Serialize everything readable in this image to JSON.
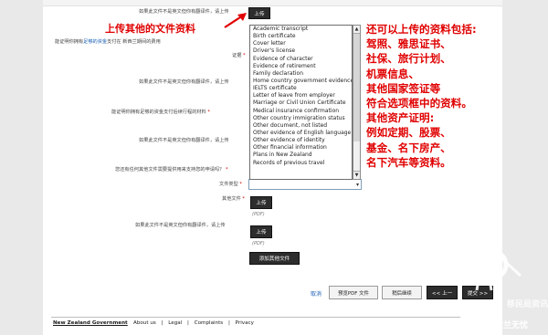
{
  "annotations": {
    "upload_heading": "上传其他的文件资料",
    "right_lines": [
      "还可以上传的资料包括:",
      "驾照、雅思证书、",
      "社保、旅行计划、",
      "机票信息、",
      "其他国家签证等",
      "符合选项框中的资料。",
      "其他资产证明:",
      "例如定期、股票、",
      "基金、名下房产、",
      "名下汽车等资料。"
    ]
  },
  "form": {
    "row1_label": "如果此文件不是英文但你有翻译件，请上传",
    "upload_btn": "上传",
    "funds_question_prefix": "能证明你拥有",
    "funds_question_link": "足够的资金",
    "funds_question_suffix": "支付在 新西兰期间的费用",
    "evidence_label": "证据",
    "row3_label": "如果此文件不是英文但你有翻译件，请上传",
    "onward_label": "能证明你拥有足够的资金支付后续行程的材料",
    "row5_label": "如果此文件不是英文但你有翻译件，请上传",
    "other_docs_question": "您还有任何其他文件需要提供用来支持您的申请吗？",
    "doc_type_label": "文件类型",
    "other_doc_label": "其他文件",
    "pdf_hint": "(PDF)",
    "row_last_label": "如果此文件不是英文但你有翻译件，请上传",
    "add_other_btn": "添加其他文件"
  },
  "dropdown": {
    "options": [
      "Academic transcript",
      "Birth certificate",
      "Cover letter",
      "Driver's license",
      "Evidence of character",
      "Evidence of retirement",
      "Family declaration",
      "Home country government evidence",
      "IELTS certificate",
      "Letter of leave from employer",
      "Marriage or Civil Union Certificate",
      "Medical insurance confirmation",
      "Other country immigration status",
      "Other document, not listed",
      "Other evidence of English language",
      "Other evidence of identity",
      "Other financial information",
      "Plans in New Zealand",
      "Records of previous travel"
    ]
  },
  "actions": {
    "cancel": "取消",
    "preview_pdf": "预览PDF 文件",
    "save_later": "稍后继续",
    "prev": "<< 上一",
    "submit": "提交 >>"
  },
  "footer": {
    "brand": "New Zealand Government",
    "links": [
      "About us",
      "Legal",
      "Complaints",
      "Privacy"
    ]
  },
  "watermark": {
    "top_text": "公号：移民局资讯",
    "char_big": "新",
    "sub_text": "西兰无忧"
  }
}
